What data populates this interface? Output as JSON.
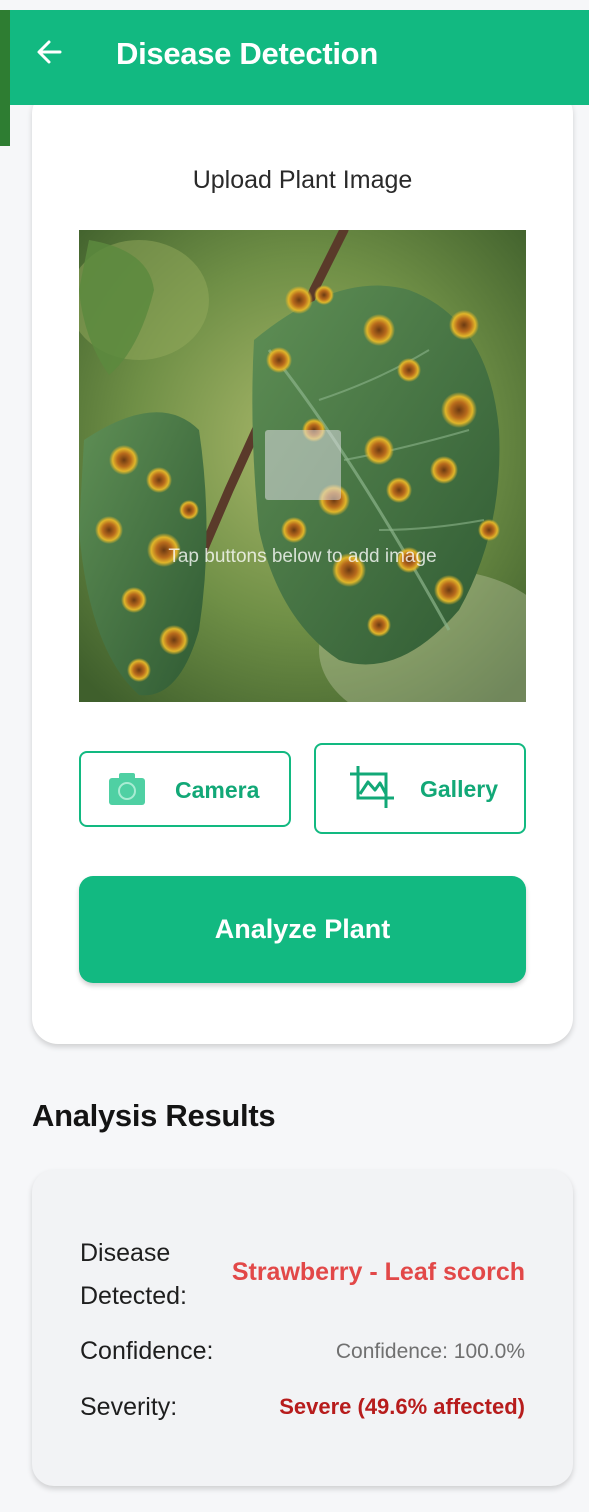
{
  "app_bar": {
    "title": "Disease Detection",
    "back_icon": "arrow-left-icon",
    "background_color": "#12b981"
  },
  "upload": {
    "title": "Upload Plant Image",
    "image_hint": "Tap buttons below to add image",
    "camera_label": "Camera",
    "camera_icon": "camera-icon",
    "gallery_label": "Gallery",
    "gallery_icon": "image-crop-icon",
    "analyze_label": "Analyze Plant"
  },
  "results": {
    "heading": "Analysis Results",
    "disease_label": "Disease Detected:",
    "disease_value": "Strawberry - Leaf scorch",
    "confidence_label": "Confidence:",
    "confidence_value": "Confidence: 100.0%",
    "severity_label": "Severity:",
    "severity_value": "Severe (49.6% affected)",
    "disease_color": "#e24848",
    "severity_color": "#b71c1c"
  }
}
